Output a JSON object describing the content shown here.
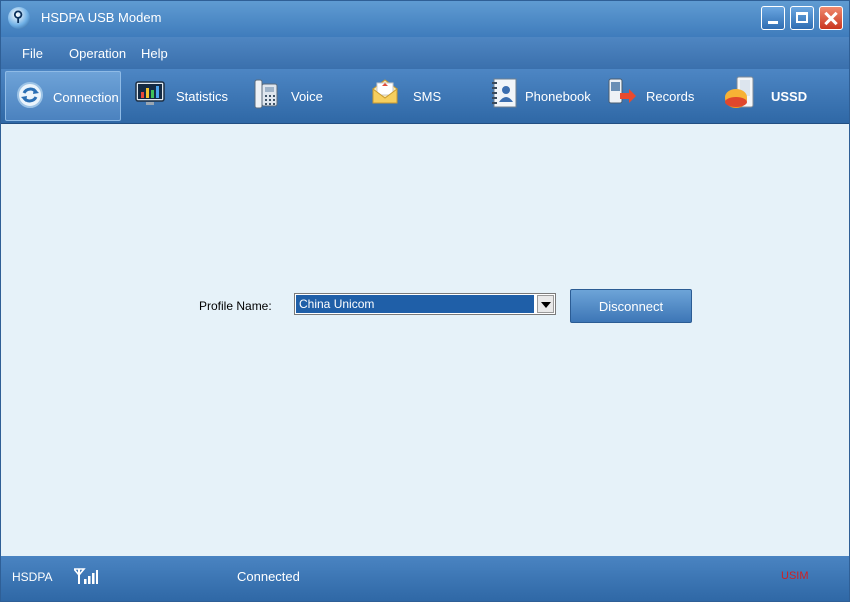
{
  "window": {
    "title": "HSDPA USB Modem"
  },
  "menu": {
    "items": [
      "File",
      "Operation",
      "Help"
    ]
  },
  "toolbar": {
    "tabs": [
      {
        "label": "Connection",
        "icon": "connection-icon",
        "active": true
      },
      {
        "label": "Statistics",
        "icon": "statistics-monitor-icon"
      },
      {
        "label": "Voice",
        "icon": "phone-icon"
      },
      {
        "label": "SMS",
        "icon": "envelope-icon"
      },
      {
        "label": "Phonebook",
        "icon": "contact-book-icon"
      },
      {
        "label": "Records",
        "icon": "records-icon"
      },
      {
        "label": "USSD",
        "icon": "ussd-icon"
      }
    ]
  },
  "connection": {
    "profile_label": "Profile Name:",
    "profile_value": "China Unicom",
    "disconnect_label": "Disconnect"
  },
  "status": {
    "network": "HSDPA",
    "connection": "Connected",
    "sim": "USIM",
    "sim_color": "#d22020",
    "signal_icon": "signal-strength-icon"
  },
  "colors": {
    "title_bar": "#3f7cbc",
    "content_bg": "#e6f2f9",
    "selection": "#1f5fa8"
  }
}
